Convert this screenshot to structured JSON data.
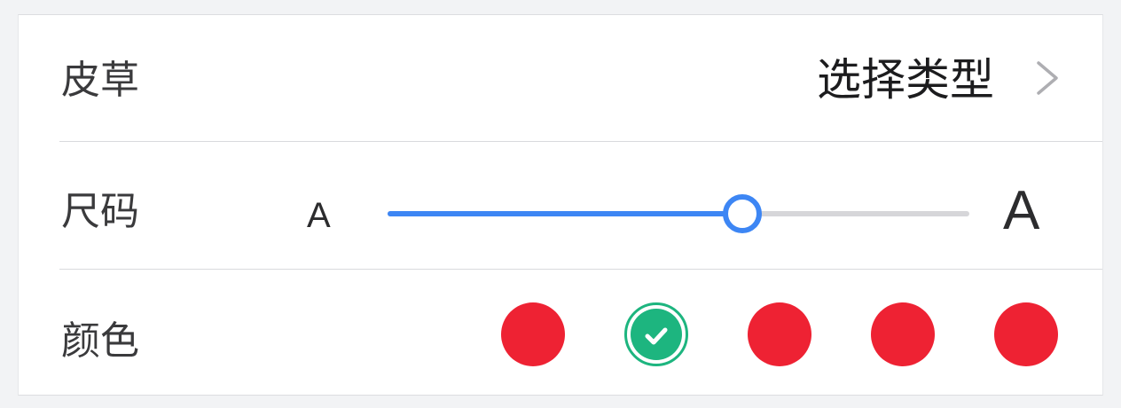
{
  "material": {
    "label": "皮草",
    "value": "选择类型",
    "chevron_icon": "chevron-right-icon"
  },
  "size": {
    "label": "尺码",
    "small_label": "A",
    "large_label": "A",
    "slider_value": 0.61,
    "accent_color": "#3d86f4",
    "track_color": "#d6d6d9"
  },
  "color": {
    "label": "颜色",
    "swatches": [
      {
        "color": "#ee2233",
        "selected": false
      },
      {
        "color": "#1db57f",
        "selected": true
      },
      {
        "color": "#ee2233",
        "selected": false
      },
      {
        "color": "#ee2233",
        "selected": false
      },
      {
        "color": "#ee2233",
        "selected": false
      }
    ],
    "selected_icon": "check-icon"
  }
}
